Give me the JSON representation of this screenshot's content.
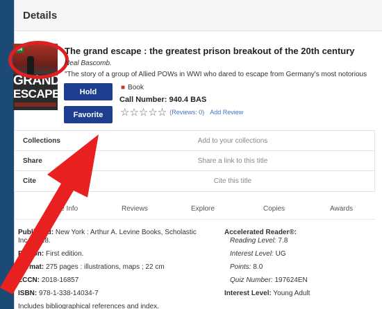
{
  "modal": {
    "title": "Details"
  },
  "cover": {
    "logo": "IN",
    "line1": "GRAND",
    "line2": "ESCAPE"
  },
  "book": {
    "title": "The grand escape : the greatest prison breakout of the 20th century",
    "author": "Neal Bascomb.",
    "description": "\"The story of a group of Allied POWs in WWI who dared to escape from Germany's most notorious",
    "format": "Book",
    "call_number": "Call Number: 940.4 BAS",
    "reviews": "(Reviews: 0)",
    "add_review": "Add Review"
  },
  "buttons": {
    "hold": "Hold",
    "favorite": "Favorite"
  },
  "actions": [
    {
      "label": "Collections",
      "value": "Add to your collections"
    },
    {
      "label": "Share",
      "value": "Share a link to this title"
    },
    {
      "label": "Cite",
      "value": "Cite this title"
    }
  ],
  "tabs": [
    "More Info",
    "Reviews",
    "Explore",
    "Copies",
    "Awards"
  ],
  "details": {
    "published_label": "Published:",
    "published_value": "New York : Arthur A. Levine Books, Scholastic",
    "published_cont": "Inc., 2018.",
    "edition_label": "Edition:",
    "edition_value": "First edition.",
    "format_label": "Format:",
    "format_value": "275 pages : illustrations, maps ; 22 cm",
    "lccn_label": "LCCN:",
    "lccn_value": "2018-16857",
    "isbn_label": "ISBN:",
    "isbn_value": "978-1-338-14034-7",
    "note": "Includes bibliographical references and index."
  },
  "ar": {
    "label": "Accelerated Reader®:",
    "reading_level": "Reading Level: ",
    "reading_value": "7.8",
    "interest_level": "Interest Level: ",
    "interest_value": "UG",
    "points": "Points: ",
    "points_value": "8.0",
    "quiz": "Quiz Number: ",
    "quiz_value": "197624EN",
    "interest_label": "Interest Level:",
    "interest_label_value": "Young Adult"
  },
  "colors": {
    "button": "#1e3f8f",
    "annotation": "#e02020",
    "link": "#4472c4"
  }
}
